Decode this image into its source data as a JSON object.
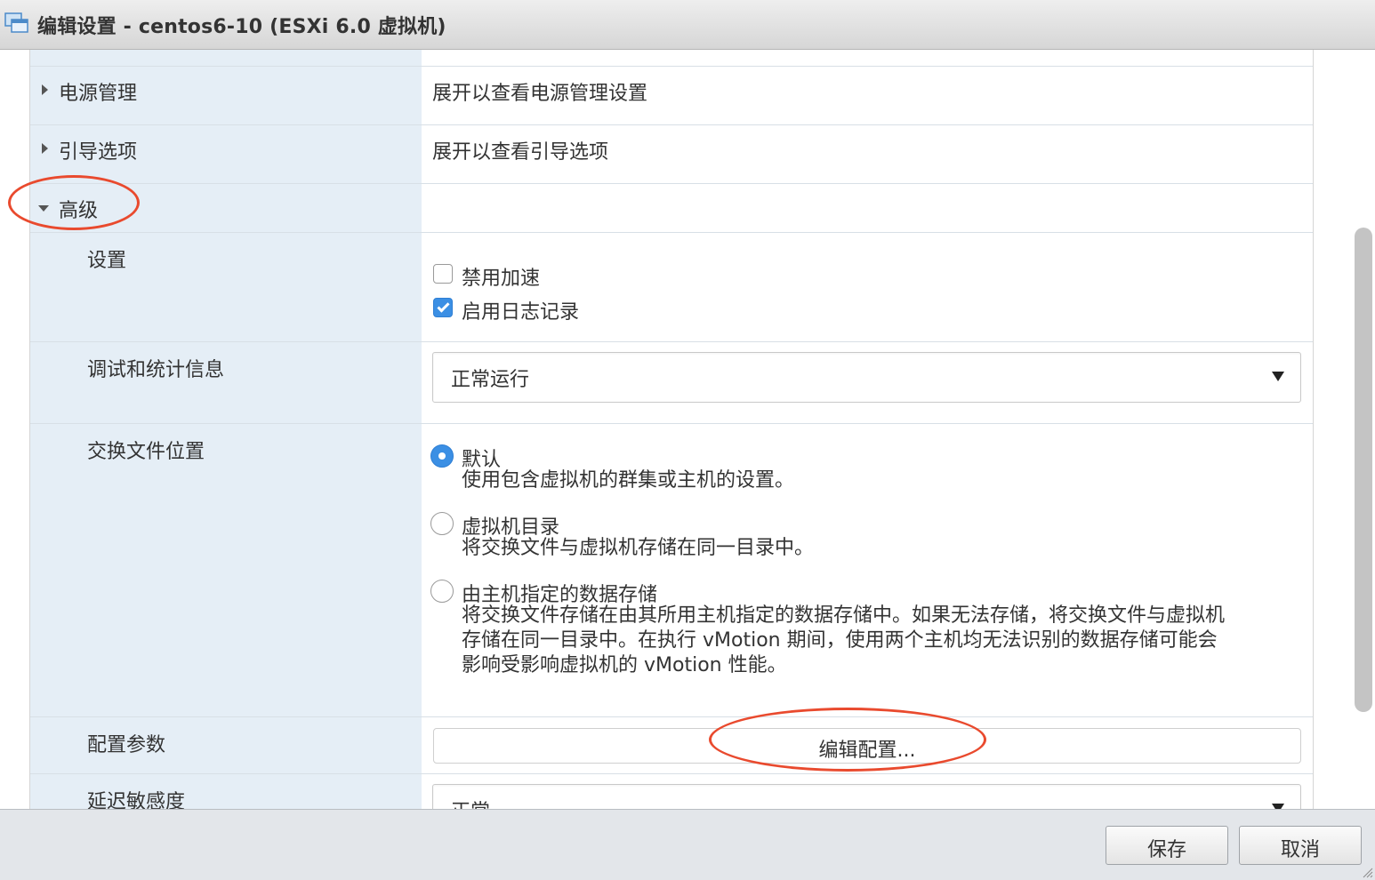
{
  "window": {
    "title": "编辑设置 - centos6-10 (ESXi 6.0 虚拟机)",
    "icon": "vm-window-icon"
  },
  "rows": {
    "power": {
      "label": "电源管理",
      "value": "展开以查看电源管理设置",
      "expanded": false
    },
    "boot": {
      "label": "引导选项",
      "value": "展开以查看引导选项",
      "expanded": false
    },
    "advanced": {
      "label": "高级",
      "expanded": true
    },
    "settings": {
      "label": "设置",
      "options": [
        {
          "label": "禁用加速",
          "checked": false
        },
        {
          "label": "启用日志记录",
          "checked": true
        }
      ]
    },
    "debug": {
      "label": "调试和统计信息",
      "selected": "正常运行"
    },
    "swap": {
      "label": "交换文件位置",
      "options": [
        {
          "label": "默认",
          "desc": "使用包含虚拟机的群集或主机的设置。",
          "selected": true
        },
        {
          "label": "虚拟机目录",
          "desc": "将交换文件与虚拟机存储在同一目录中。",
          "selected": false
        },
        {
          "label": "由主机指定的数据存储",
          "desc_lines": [
            "将交换文件存储在由其所用主机指定的数据存储中。如果无法存储，将交换文件与虚拟机",
            "存储在同一目录中。在执行 vMotion 期间，使用两个主机均无法识别的数据存储可能会",
            "影响受影响虚拟机的 vMotion 性能。"
          ],
          "selected": false
        }
      ]
    },
    "config": {
      "label": "配置参数",
      "button": "编辑配置..."
    },
    "latency": {
      "label": "延迟敏感度",
      "selected": "正常"
    }
  },
  "footer": {
    "save": "保存",
    "cancel": "取消"
  },
  "colors": {
    "label_bg": "#e5eef6",
    "accent": "#3b8fe4",
    "annotation": "#e94a2e"
  }
}
